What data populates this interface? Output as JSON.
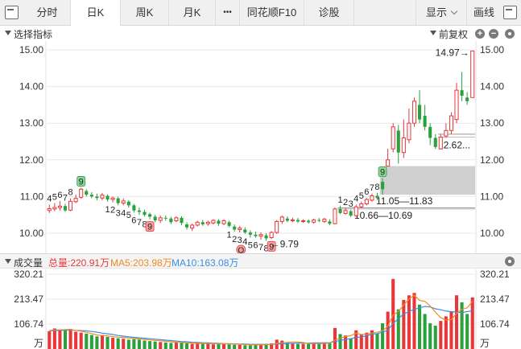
{
  "toolbar": {
    "tabs": [
      {
        "label": "分时"
      },
      {
        "label": "日K"
      },
      {
        "label": "周K"
      },
      {
        "label": "月K"
      },
      {
        "label": "•••"
      },
      {
        "label": "同花顺F10"
      },
      {
        "label": "诊股"
      }
    ],
    "display_label": "显示",
    "draw_label": "画线"
  },
  "indicator_bar": {
    "select_label": "选择指标",
    "adjust_label": "前复权",
    "zoom_in": "+",
    "zoom_out": "−"
  },
  "volume_bar": {
    "name": "成交量",
    "total": "总量:220.91万",
    "ma5": "MA5:203.98万",
    "ma10": "MA10:163.08万"
  },
  "colors": {
    "up": "#e8363a",
    "down": "#2aa13d",
    "ma5": "#f08a24",
    "ma10": "#3a8ee6",
    "grid": "#e9e9e9",
    "gap": "#cfcfcf"
  },
  "chart_data": [
    {
      "type": "candlestick",
      "y_ticks": [
        "15.00",
        "14.00",
        "13.00",
        "12.00",
        "11.00",
        "10.00"
      ],
      "ylim": [
        9.6,
        15.2
      ],
      "candles": [
        {
          "o": 10.62,
          "c": 10.67,
          "h": 10.78,
          "l": 10.55
        },
        {
          "o": 10.66,
          "c": 10.7,
          "h": 10.82,
          "l": 10.6
        },
        {
          "o": 10.7,
          "c": 10.74,
          "h": 10.88,
          "l": 10.62
        },
        {
          "o": 10.74,
          "c": 10.62,
          "h": 10.8,
          "l": 10.58
        },
        {
          "o": 10.63,
          "c": 10.87,
          "h": 10.95,
          "l": 10.6
        },
        {
          "o": 10.86,
          "c": 10.95,
          "h": 11.05,
          "l": 10.82
        },
        {
          "o": 10.98,
          "c": 11.2,
          "h": 11.24,
          "l": 10.94
        },
        {
          "o": 11.15,
          "c": 11.05,
          "h": 11.2,
          "l": 11.0
        },
        {
          "o": 11.05,
          "c": 11.0,
          "h": 11.12,
          "l": 10.95
        },
        {
          "o": 11.0,
          "c": 10.96,
          "h": 11.08,
          "l": 10.9
        },
        {
          "o": 10.96,
          "c": 11.04,
          "h": 11.1,
          "l": 10.9
        },
        {
          "o": 11.02,
          "c": 10.92,
          "h": 11.06,
          "l": 10.86
        },
        {
          "o": 10.92,
          "c": 10.96,
          "h": 11.0,
          "l": 10.84
        },
        {
          "o": 10.95,
          "c": 10.82,
          "h": 11.0,
          "l": 10.76
        },
        {
          "o": 10.82,
          "c": 10.88,
          "h": 10.95,
          "l": 10.76
        },
        {
          "o": 10.86,
          "c": 10.76,
          "h": 10.9,
          "l": 10.7
        },
        {
          "o": 10.76,
          "c": 10.62,
          "h": 10.8,
          "l": 10.56
        },
        {
          "o": 10.62,
          "c": 10.58,
          "h": 10.7,
          "l": 10.5
        },
        {
          "o": 10.58,
          "c": 10.5,
          "h": 10.64,
          "l": 10.45
        },
        {
          "o": 10.52,
          "c": 10.45,
          "h": 10.56,
          "l": 10.38
        },
        {
          "o": 10.45,
          "c": 10.35,
          "h": 10.5,
          "l": 10.3
        },
        {
          "o": 10.35,
          "c": 10.42,
          "h": 10.48,
          "l": 10.28
        },
        {
          "o": 10.42,
          "c": 10.4,
          "h": 10.48,
          "l": 10.34
        },
        {
          "o": 10.4,
          "c": 10.3,
          "h": 10.45,
          "l": 10.25
        },
        {
          "o": 10.34,
          "c": 10.42,
          "h": 10.46,
          "l": 10.3
        },
        {
          "o": 10.42,
          "c": 10.28,
          "h": 10.46,
          "l": 10.22
        },
        {
          "o": 10.24,
          "c": 10.16,
          "h": 10.3,
          "l": 10.1
        },
        {
          "o": 10.14,
          "c": 10.22,
          "h": 10.26,
          "l": 10.06
        },
        {
          "o": 10.22,
          "c": 10.3,
          "h": 10.34,
          "l": 10.18
        },
        {
          "o": 10.3,
          "c": 10.24,
          "h": 10.36,
          "l": 10.2
        },
        {
          "o": 10.26,
          "c": 10.3,
          "h": 10.34,
          "l": 10.2
        },
        {
          "o": 10.28,
          "c": 10.35,
          "h": 10.38,
          "l": 10.24
        },
        {
          "o": 10.34,
          "c": 10.26,
          "h": 10.38,
          "l": 10.2
        },
        {
          "o": 10.26,
          "c": 10.34,
          "h": 10.38,
          "l": 10.22
        },
        {
          "o": 10.3,
          "c": 10.2,
          "h": 10.34,
          "l": 10.16
        },
        {
          "o": 10.18,
          "c": 10.1,
          "h": 10.24,
          "l": 10.04
        },
        {
          "o": 10.1,
          "c": 10.14,
          "h": 10.2,
          "l": 10.02
        },
        {
          "o": 10.1,
          "c": 10.02,
          "h": 10.16,
          "l": 9.98
        },
        {
          "o": 10.02,
          "c": 9.96,
          "h": 10.08,
          "l": 9.88
        },
        {
          "o": 9.96,
          "c": 9.92,
          "h": 10.04,
          "l": 9.88
        },
        {
          "o": 9.92,
          "c": 9.96,
          "h": 10.02,
          "l": 9.82
        },
        {
          "o": 9.94,
          "c": 9.86,
          "h": 10.0,
          "l": 9.79
        },
        {
          "o": 9.88,
          "c": 10.02,
          "h": 10.06,
          "l": 9.84
        },
        {
          "o": 10.02,
          "c": 10.32,
          "h": 10.36,
          "l": 9.98
        },
        {
          "o": 10.32,
          "c": 10.44,
          "h": 10.48,
          "l": 10.26
        },
        {
          "o": 10.4,
          "c": 10.34,
          "h": 10.46,
          "l": 10.3
        },
        {
          "o": 10.34,
          "c": 10.36,
          "h": 10.42,
          "l": 10.3
        },
        {
          "o": 10.36,
          "c": 10.32,
          "h": 10.42,
          "l": 10.28
        },
        {
          "o": 10.32,
          "c": 10.34,
          "h": 10.38,
          "l": 10.28
        },
        {
          "o": 10.34,
          "c": 10.3,
          "h": 10.38,
          "l": 10.26
        },
        {
          "o": 10.3,
          "c": 10.36,
          "h": 10.4,
          "l": 10.26
        },
        {
          "o": 10.36,
          "c": 10.34,
          "h": 10.42,
          "l": 10.3
        },
        {
          "o": 10.32,
          "c": 10.38,
          "h": 10.42,
          "l": 10.28
        },
        {
          "o": 10.32,
          "c": 10.26,
          "h": 10.38,
          "l": 10.22
        },
        {
          "o": 10.26,
          "c": 10.66,
          "h": 10.7,
          "l": 10.24
        },
        {
          "o": 10.66,
          "c": 10.55,
          "h": 10.75,
          "l": 10.52
        },
        {
          "o": 10.54,
          "c": 10.62,
          "h": 10.68,
          "l": 10.5
        },
        {
          "o": 10.6,
          "c": 10.48,
          "h": 10.64,
          "l": 10.44
        },
        {
          "o": 10.48,
          "c": 10.72,
          "h": 10.78,
          "l": 10.45
        },
        {
          "o": 10.72,
          "c": 10.8,
          "h": 10.86,
          "l": 10.68
        },
        {
          "o": 10.8,
          "c": 10.92,
          "h": 10.96,
          "l": 10.76
        },
        {
          "o": 10.9,
          "c": 11.02,
          "h": 11.08,
          "l": 10.86
        },
        {
          "o": 11.02,
          "c": 10.96,
          "h": 11.1,
          "l": 10.9
        },
        {
          "o": 11.4,
          "c": 11.2,
          "h": 11.5,
          "l": 11.05
        },
        {
          "o": 11.83,
          "c": 12.0,
          "h": 12.3,
          "l": 11.83
        },
        {
          "o": 12.3,
          "c": 12.9,
          "h": 13.0,
          "l": 12.2
        },
        {
          "o": 12.8,
          "c": 12.2,
          "h": 12.95,
          "l": 11.9
        },
        {
          "o": 12.2,
          "c": 12.6,
          "h": 13.1,
          "l": 12.05
        },
        {
          "o": 12.55,
          "c": 13.0,
          "h": 13.4,
          "l": 12.45
        },
        {
          "o": 13.0,
          "c": 13.6,
          "h": 13.7,
          "l": 12.9
        },
        {
          "o": 13.5,
          "c": 13.1,
          "h": 13.9,
          "l": 13.0
        },
        {
          "o": 13.2,
          "c": 12.9,
          "h": 13.5,
          "l": 12.8
        },
        {
          "o": 12.9,
          "c": 12.6,
          "h": 13.0,
          "l": 12.4
        },
        {
          "o": 12.6,
          "c": 12.35,
          "h": 12.7,
          "l": 12.3
        },
        {
          "o": 12.3,
          "c": 12.62,
          "h": 12.7,
          "l": 12.28
        },
        {
          "o": 12.65,
          "c": 12.8,
          "h": 13.0,
          "l": 12.6
        },
        {
          "o": 12.8,
          "c": 13.2,
          "h": 13.3,
          "l": 12.7
        },
        {
          "o": 13.1,
          "c": 13.9,
          "h": 14.1,
          "l": 13.0
        },
        {
          "o": 13.9,
          "c": 13.75,
          "h": 14.4,
          "l": 13.6
        },
        {
          "o": 13.7,
          "c": 13.6,
          "h": 13.85,
          "l": 13.5
        },
        {
          "o": 13.7,
          "c": 14.97,
          "h": 14.97,
          "l": 13.7
        }
      ],
      "gaps": [
        {
          "low": 12.62,
          "high": 12.7,
          "label": "12.62..."
        },
        {
          "low": 11.05,
          "high": 11.83,
          "label": "11.05—11.83"
        },
        {
          "low": 10.66,
          "high": 10.69,
          "label": "10.66—10.69"
        }
      ],
      "annotations": [
        {
          "text": "14.97→",
          "kind": "price"
        },
        {
          "text": "←9.79",
          "kind": "price"
        }
      ],
      "td_counts": [
        {
          "i": 0,
          "t": "4"
        },
        {
          "i": 1,
          "t": "5"
        },
        {
          "i": 2,
          "t": "6"
        },
        {
          "i": 3,
          "t": "7"
        },
        {
          "i": 4,
          "t": "8"
        },
        {
          "i": 6,
          "t": "9",
          "box": "green"
        },
        {
          "i": 11,
          "t": "1"
        },
        {
          "i": 12,
          "t": "2"
        },
        {
          "i": 13,
          "t": "3"
        },
        {
          "i": 14,
          "t": "4"
        },
        {
          "i": 15,
          "t": "5"
        },
        {
          "i": 16,
          "t": "6"
        },
        {
          "i": 17,
          "t": "7"
        },
        {
          "i": 18,
          "t": "8"
        },
        {
          "i": 19,
          "t": "9",
          "box": "red"
        },
        {
          "i": 34,
          "t": "1"
        },
        {
          "i": 35,
          "t": "2"
        },
        {
          "i": 36,
          "t": "3"
        },
        {
          "i": 37,
          "t": "4"
        },
        {
          "i": 38,
          "t": "5"
        },
        {
          "i": 39,
          "t": "6"
        },
        {
          "i": 40,
          "t": "7"
        },
        {
          "i": 41,
          "t": "8"
        },
        {
          "i": 42,
          "t": "9",
          "box": "red"
        },
        {
          "i": 55,
          "t": "1"
        },
        {
          "i": 56,
          "t": "2"
        },
        {
          "i": 57,
          "t": "3"
        },
        {
          "i": 58,
          "t": "4"
        },
        {
          "i": 59,
          "t": "5"
        },
        {
          "i": 60,
          "t": "6"
        },
        {
          "i": 61,
          "t": "7"
        },
        {
          "i": 62,
          "t": "8"
        },
        {
          "i": 63,
          "t": "9",
          "box": "green"
        }
      ],
      "q_marker": "Q"
    },
    {
      "type": "bar",
      "y_ticks": [
        "320.21",
        "213.47",
        "106.74"
      ],
      "unit": "万",
      "ylim": [
        0,
        320.21
      ],
      "volumes": [
        76,
        88,
        82,
        84,
        86,
        74,
        70,
        66,
        60,
        54,
        60,
        52,
        48,
        46,
        44,
        40,
        42,
        40,
        36,
        34,
        32,
        30,
        28,
        26,
        28,
        26,
        24,
        22,
        24,
        22,
        24,
        20,
        22,
        22,
        20,
        18,
        18,
        16,
        16,
        18,
        20,
        22,
        24,
        40,
        36,
        26,
        24,
        22,
        22,
        22,
        24,
        24,
        28,
        26,
        90,
        64,
        58,
        46,
        80,
        62,
        70,
        80,
        66,
        110,
        160,
        300,
        170,
        210,
        230,
        240,
        190,
        150,
        110,
        100,
        120,
        140,
        160,
        230,
        200,
        150,
        221
      ],
      "ma5": [
        80,
        82,
        82,
        83,
        83,
        80,
        76,
        72,
        66,
        60,
        58,
        56,
        53,
        51,
        50,
        47,
        45,
        43,
        41,
        39,
        37,
        35,
        33,
        31,
        29,
        28,
        26,
        25,
        24,
        24,
        23,
        23,
        22,
        22,
        22,
        21,
        20,
        19,
        18,
        18,
        18,
        19,
        20,
        24,
        27,
        28,
        30,
        30,
        28,
        23,
        23,
        23,
        24,
        25,
        39,
        46,
        53,
        57,
        68,
        62,
        63,
        68,
        72,
        78,
        97,
        145,
        161,
        188,
        214,
        230,
        208,
        204,
        184,
        158,
        134,
        124,
        126,
        152,
        170,
        176,
        204
      ],
      "ma10": [
        78,
        79,
        80,
        80,
        81,
        80,
        79,
        78,
        75,
        72,
        68,
        65,
        62,
        58,
        55,
        52,
        50,
        48,
        46,
        44,
        42,
        40,
        38,
        36,
        34,
        32,
        31,
        29,
        28,
        27,
        26,
        25,
        24,
        23,
        23,
        22,
        21,
        21,
        20,
        20,
        20,
        20,
        20,
        21,
        22,
        23,
        24,
        25,
        25,
        25,
        26,
        26,
        27,
        27,
        32,
        37,
        41,
        44,
        50,
        51,
        57,
        63,
        66,
        72,
        80,
        110,
        130,
        150,
        160,
        170,
        176,
        182,
        180,
        172,
        168,
        162,
        160,
        158,
        156,
        160,
        163
      ]
    }
  ]
}
